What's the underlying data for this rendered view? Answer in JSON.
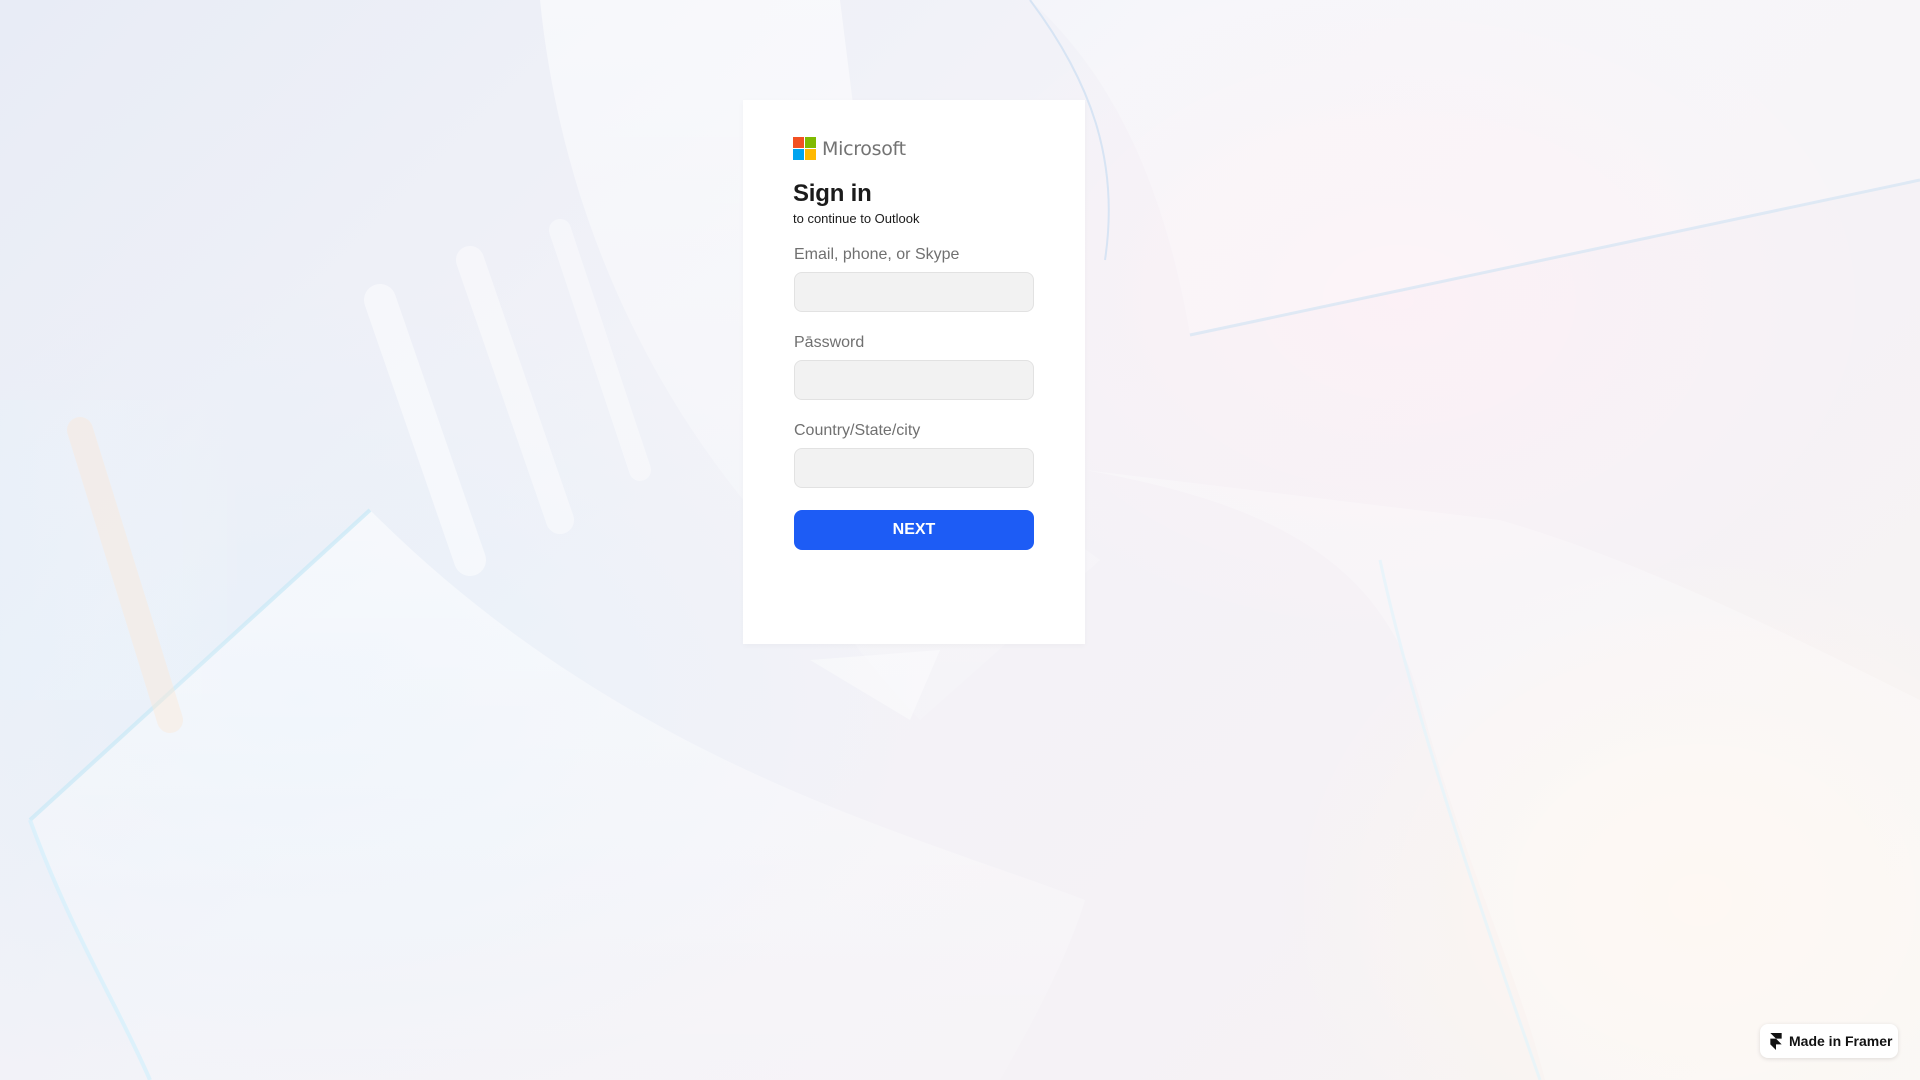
{
  "brand": {
    "name": "Microsoft",
    "logo_colors": [
      "#f25022",
      "#7fba00",
      "#00a4ef",
      "#ffb900"
    ]
  },
  "heading": {
    "title": "Sign in",
    "subtitle": "to continue to Outlook"
  },
  "form": {
    "fields": [
      {
        "label": "Email, phone, or Skype",
        "value": "",
        "placeholder": ""
      },
      {
        "label": "Pāssword",
        "value": "",
        "placeholder": ""
      },
      {
        "label": "Country/State/city",
        "value": "",
        "placeholder": ""
      }
    ],
    "next_label": "NEXT"
  },
  "badge": {
    "label": "Made in Framer",
    "icon": "framer-icon"
  },
  "colors": {
    "primary_button": "#1d5cf5",
    "label_text": "#707070",
    "input_background": "#f2f2f2"
  }
}
